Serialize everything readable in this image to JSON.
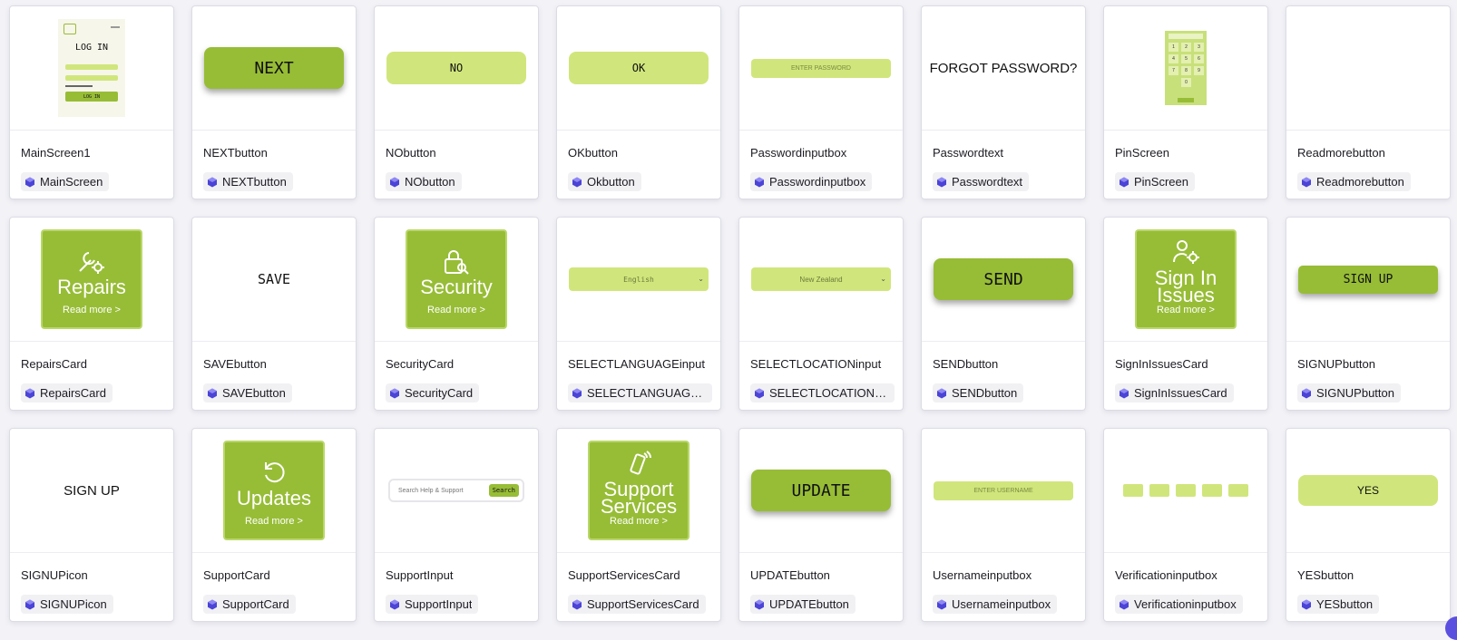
{
  "colors": {
    "brand_green": "#97bd36",
    "light_green": "#d0e67c",
    "component_icon": "#4b44d6"
  },
  "cards": [
    {
      "name": "MainScreen1",
      "component": "MainScreen",
      "preview": {
        "type": "mainscreen",
        "heading": "LOG IN",
        "button": "LOG IN"
      }
    },
    {
      "name": "NEXTbutton",
      "component": "NEXTbutton",
      "preview": {
        "type": "button-dark",
        "text": "NEXT"
      }
    },
    {
      "name": "NObutton",
      "component": "NObutton",
      "preview": {
        "type": "button-light",
        "text": "NO"
      }
    },
    {
      "name": "OKbutton",
      "component": "Okbutton",
      "preview": {
        "type": "button-light",
        "text": "OK"
      }
    },
    {
      "name": "Passwordinputbox",
      "component": "Passwordinputbox",
      "preview": {
        "type": "input",
        "text": "ENTER PASSWORD"
      }
    },
    {
      "name": "Passwordtext",
      "component": "Passwordtext",
      "preview": {
        "type": "text",
        "text": "FORGOT PASSWORD?"
      }
    },
    {
      "name": "PinScreen",
      "component": "PinScreen",
      "preview": {
        "type": "pinscreen",
        "keys": [
          "1",
          "2",
          "3",
          "4",
          "5",
          "6",
          "7",
          "8",
          "9",
          "0"
        ]
      }
    },
    {
      "name": "Readmorebutton",
      "component": "Readmorebutton",
      "preview": {
        "type": "empty"
      }
    },
    {
      "name": "RepairsCard",
      "component": "RepairsCard",
      "preview": {
        "type": "tile",
        "icon": "wrench-gear-icon",
        "title": "Repairs",
        "more": "Read more >"
      }
    },
    {
      "name": "SAVEbutton",
      "component": "SAVEbutton",
      "preview": {
        "type": "text-mono",
        "text": "SAVE"
      }
    },
    {
      "name": "SecurityCard",
      "component": "SecurityCard",
      "preview": {
        "type": "tile",
        "icon": "lock-key-icon",
        "title": "Security",
        "more": "Read more >"
      }
    },
    {
      "name": "SELECTLANGUAGEinput",
      "component": "SELECTLANGUAGEi…",
      "preview": {
        "type": "select",
        "text": "English"
      }
    },
    {
      "name": "SELECTLOCATIONinput",
      "component": "SELECTLOCATIONin…",
      "preview": {
        "type": "select",
        "text": "New Zealand"
      }
    },
    {
      "name": "SENDbutton",
      "component": "SENDbutton",
      "preview": {
        "type": "button-dark",
        "text": "SEND"
      }
    },
    {
      "name": "SignInIssuesCard",
      "component": "SignInIssuesCard",
      "preview": {
        "type": "tile",
        "icon": "user-gear-icon",
        "title": "Sign In Issues",
        "more": "Read more >"
      }
    },
    {
      "name": "SIGNUPbutton",
      "component": "SIGNUPbutton",
      "preview": {
        "type": "button-dark-sm",
        "text": "SIGN UP"
      }
    },
    {
      "name": "SIGNUPicon",
      "component": "SIGNUPicon",
      "preview": {
        "type": "text",
        "text": "SIGN UP"
      }
    },
    {
      "name": "SupportCard",
      "component": "SupportCard",
      "preview": {
        "type": "tile",
        "icon": "refresh-icon",
        "title": "Updates",
        "more": "Read more >"
      }
    },
    {
      "name": "SupportInput",
      "component": "SupportInput",
      "preview": {
        "type": "search",
        "placeholder": "Search Help & Support",
        "button": "Search"
      }
    },
    {
      "name": "SupportServicesCard",
      "component": "SupportServicesCard",
      "preview": {
        "type": "tile",
        "icon": "phone-ring-icon",
        "title": "Support Services",
        "more": "Read more >"
      }
    },
    {
      "name": "UPDATEbutton",
      "component": "UPDATEbutton",
      "preview": {
        "type": "button-dark",
        "text": "UPDATE"
      }
    },
    {
      "name": "Usernameinputbox",
      "component": "Usernameinputbox",
      "preview": {
        "type": "input",
        "text": "ENTER USERNAME"
      }
    },
    {
      "name": "Verificationinputbox",
      "component": "Verificationinputbox",
      "preview": {
        "type": "verify",
        "boxes": 5
      }
    },
    {
      "name": "YESbutton",
      "component": "YESbutton",
      "preview": {
        "type": "button-light-yes",
        "text": "YES"
      }
    }
  ]
}
